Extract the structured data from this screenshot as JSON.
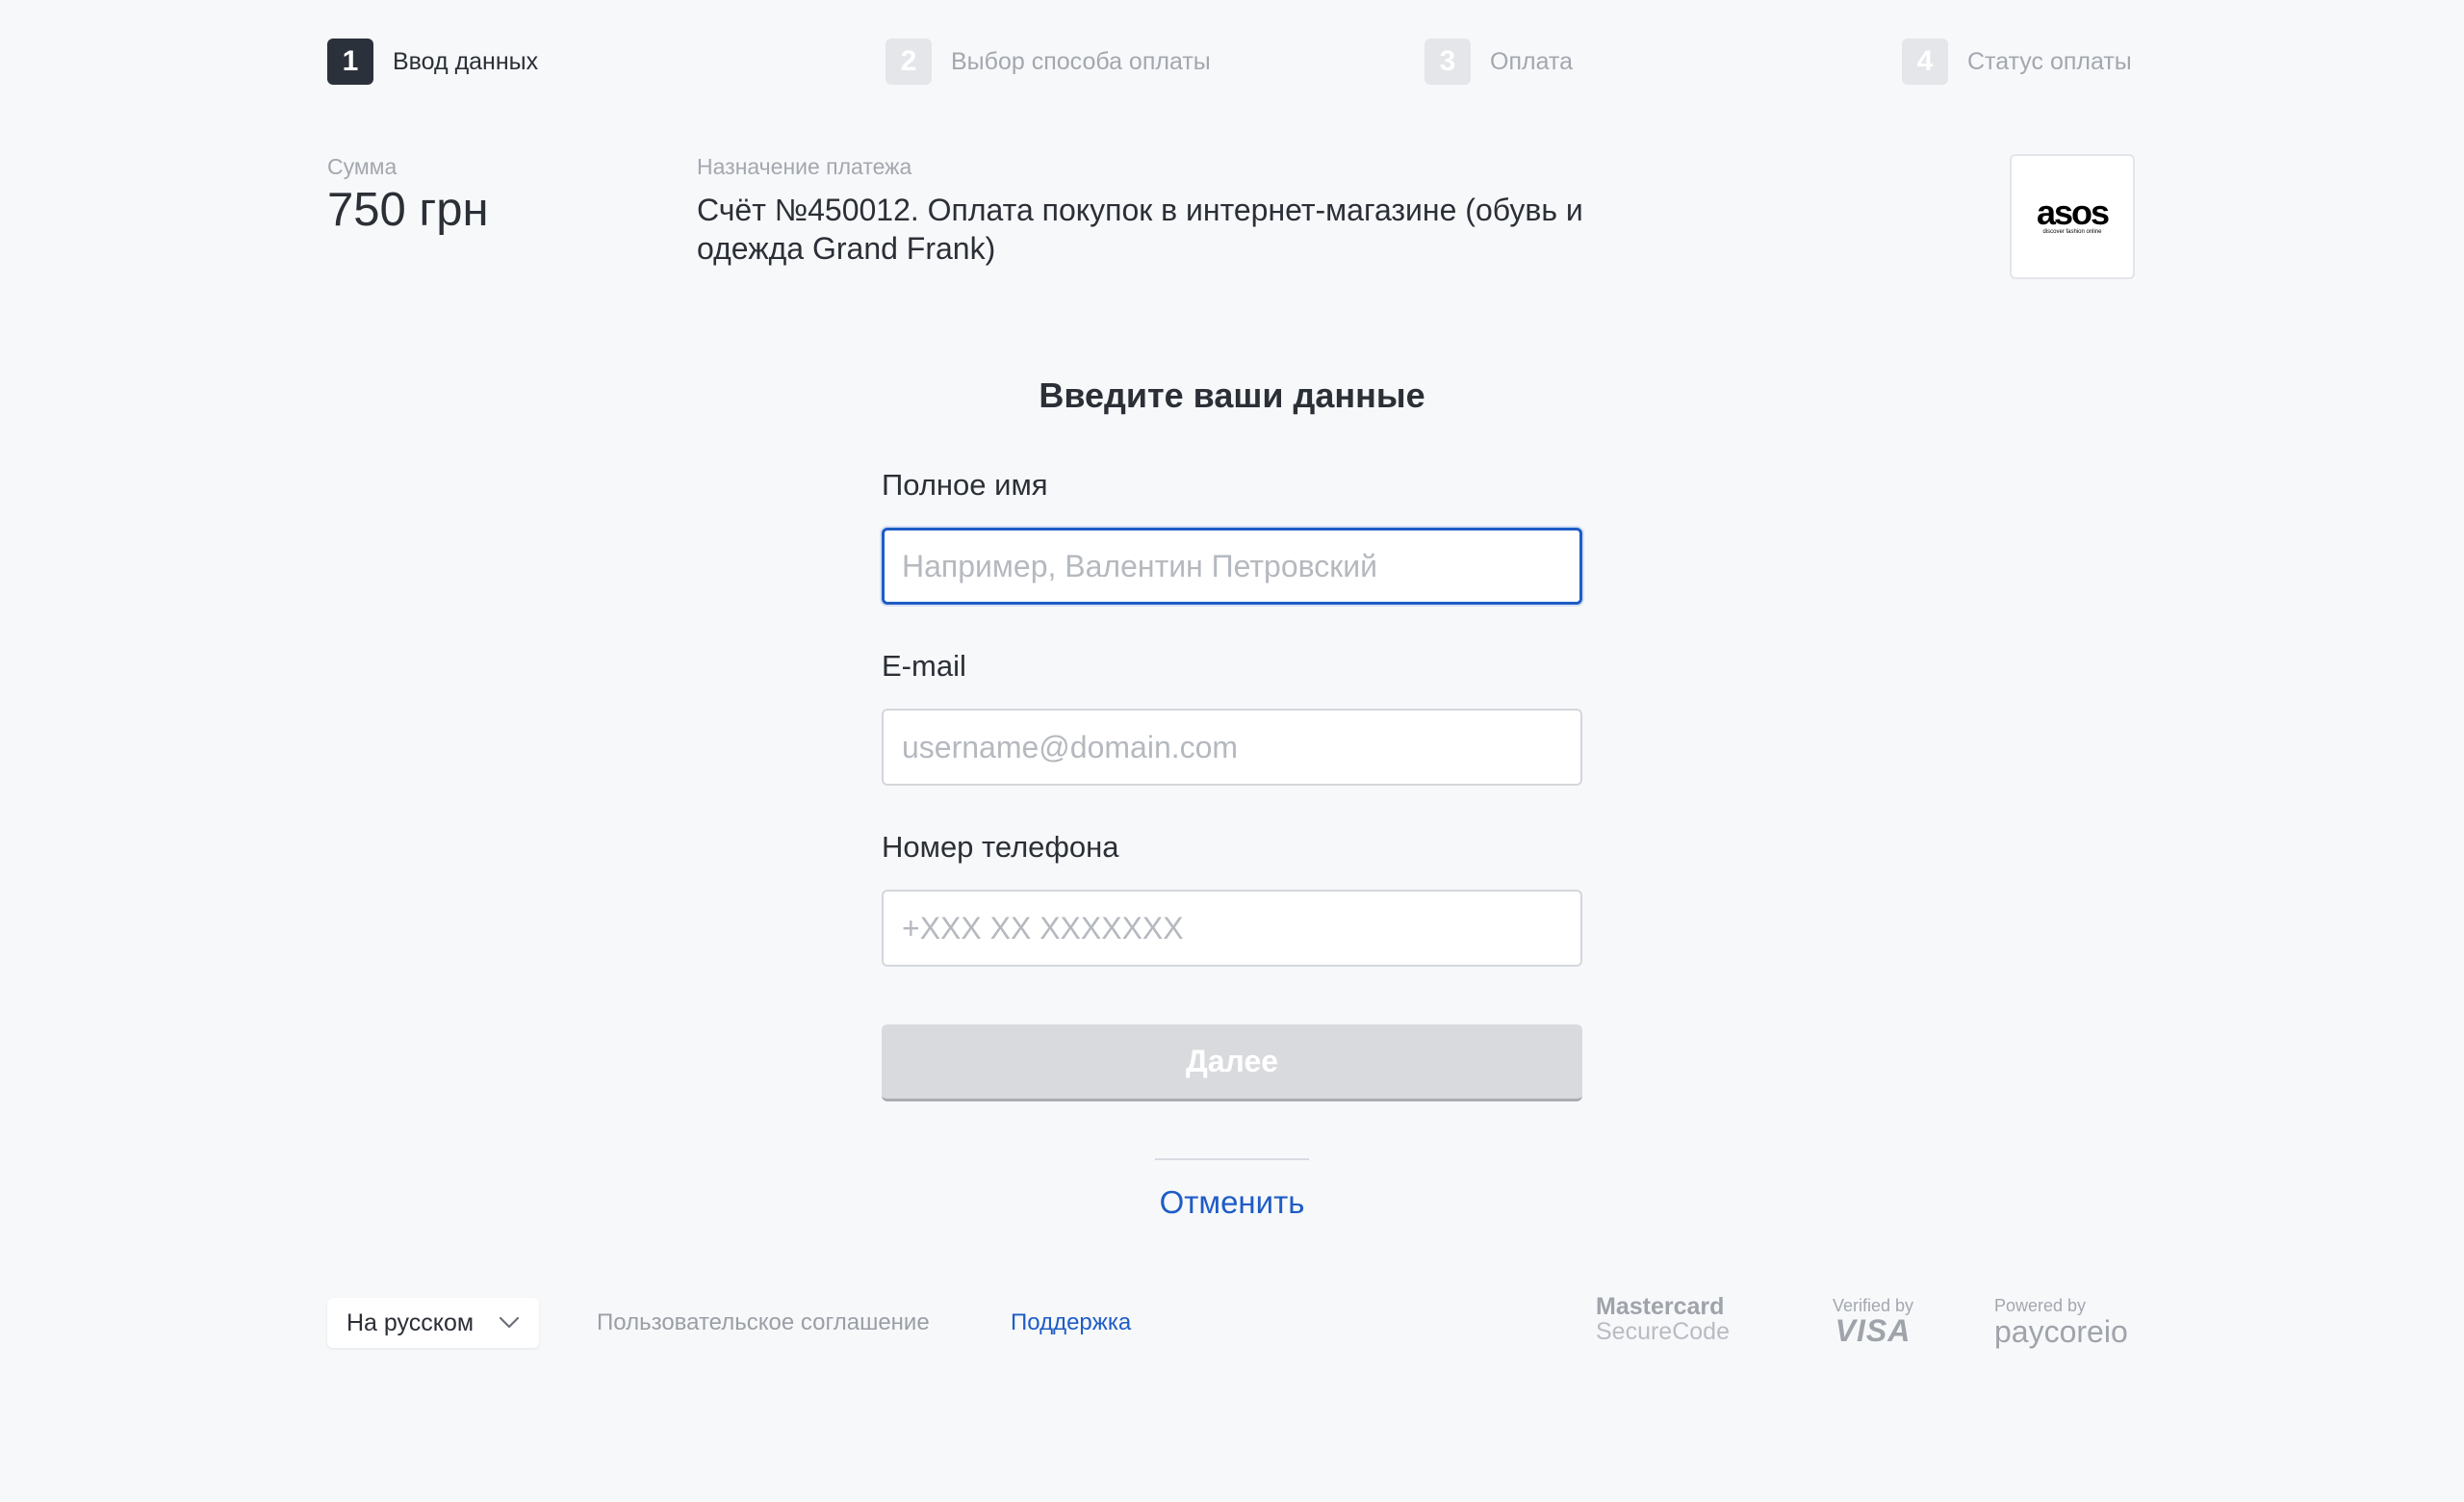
{
  "steps": [
    {
      "number": "1",
      "label": "Ввод данных",
      "active": true
    },
    {
      "number": "2",
      "label": "Выбор способа оплаты",
      "active": false
    },
    {
      "number": "3",
      "label": "Оплата",
      "active": false
    },
    {
      "number": "4",
      "label": "Статус оплаты",
      "active": false
    }
  ],
  "summary": {
    "amount_caption": "Сумма",
    "amount_value": "750 грн",
    "purpose_caption": "Назначение платежа",
    "purpose_value": "Счёт №450012. Оплата покупок в интернет-магазине (обувь и одежда Grand Frank)",
    "merchant_logo_text": "asos",
    "merchant_logo_tagline": "discover fashion online"
  },
  "form": {
    "title": "Введите ваши данные",
    "name_label": "Полное имя",
    "name_placeholder": "Например, Валентин Петровский",
    "name_value": "",
    "email_label": "E-mail",
    "email_placeholder": "username@domain.com",
    "email_value": "",
    "phone_label": "Номер телефона",
    "phone_placeholder": "+XXX XX XXXXXXX",
    "phone_value": "",
    "next_label": "Далее",
    "cancel_label": "Отменить"
  },
  "footer": {
    "language_value": "На русском",
    "terms_label": "Пользовательское соглашение",
    "support_label": "Поддержка",
    "badges": {
      "mastercard_line1": "Mastercard",
      "mastercard_line2": "SecureCode",
      "visa_line1": "Verified by",
      "visa_line2": "VISA",
      "paycore_line1": "Powered by",
      "paycore_line2": "paycoreio"
    }
  },
  "colors": {
    "background": "#f7f8fa",
    "active_step": "#2b313b",
    "inactive_step": "#e4e6ea",
    "link": "#1e5cc6",
    "focus_border": "#1e5cc6",
    "disabled_button": "#d9dadd"
  },
  "icons": {
    "language_dropdown": "chevron-down-icon"
  }
}
